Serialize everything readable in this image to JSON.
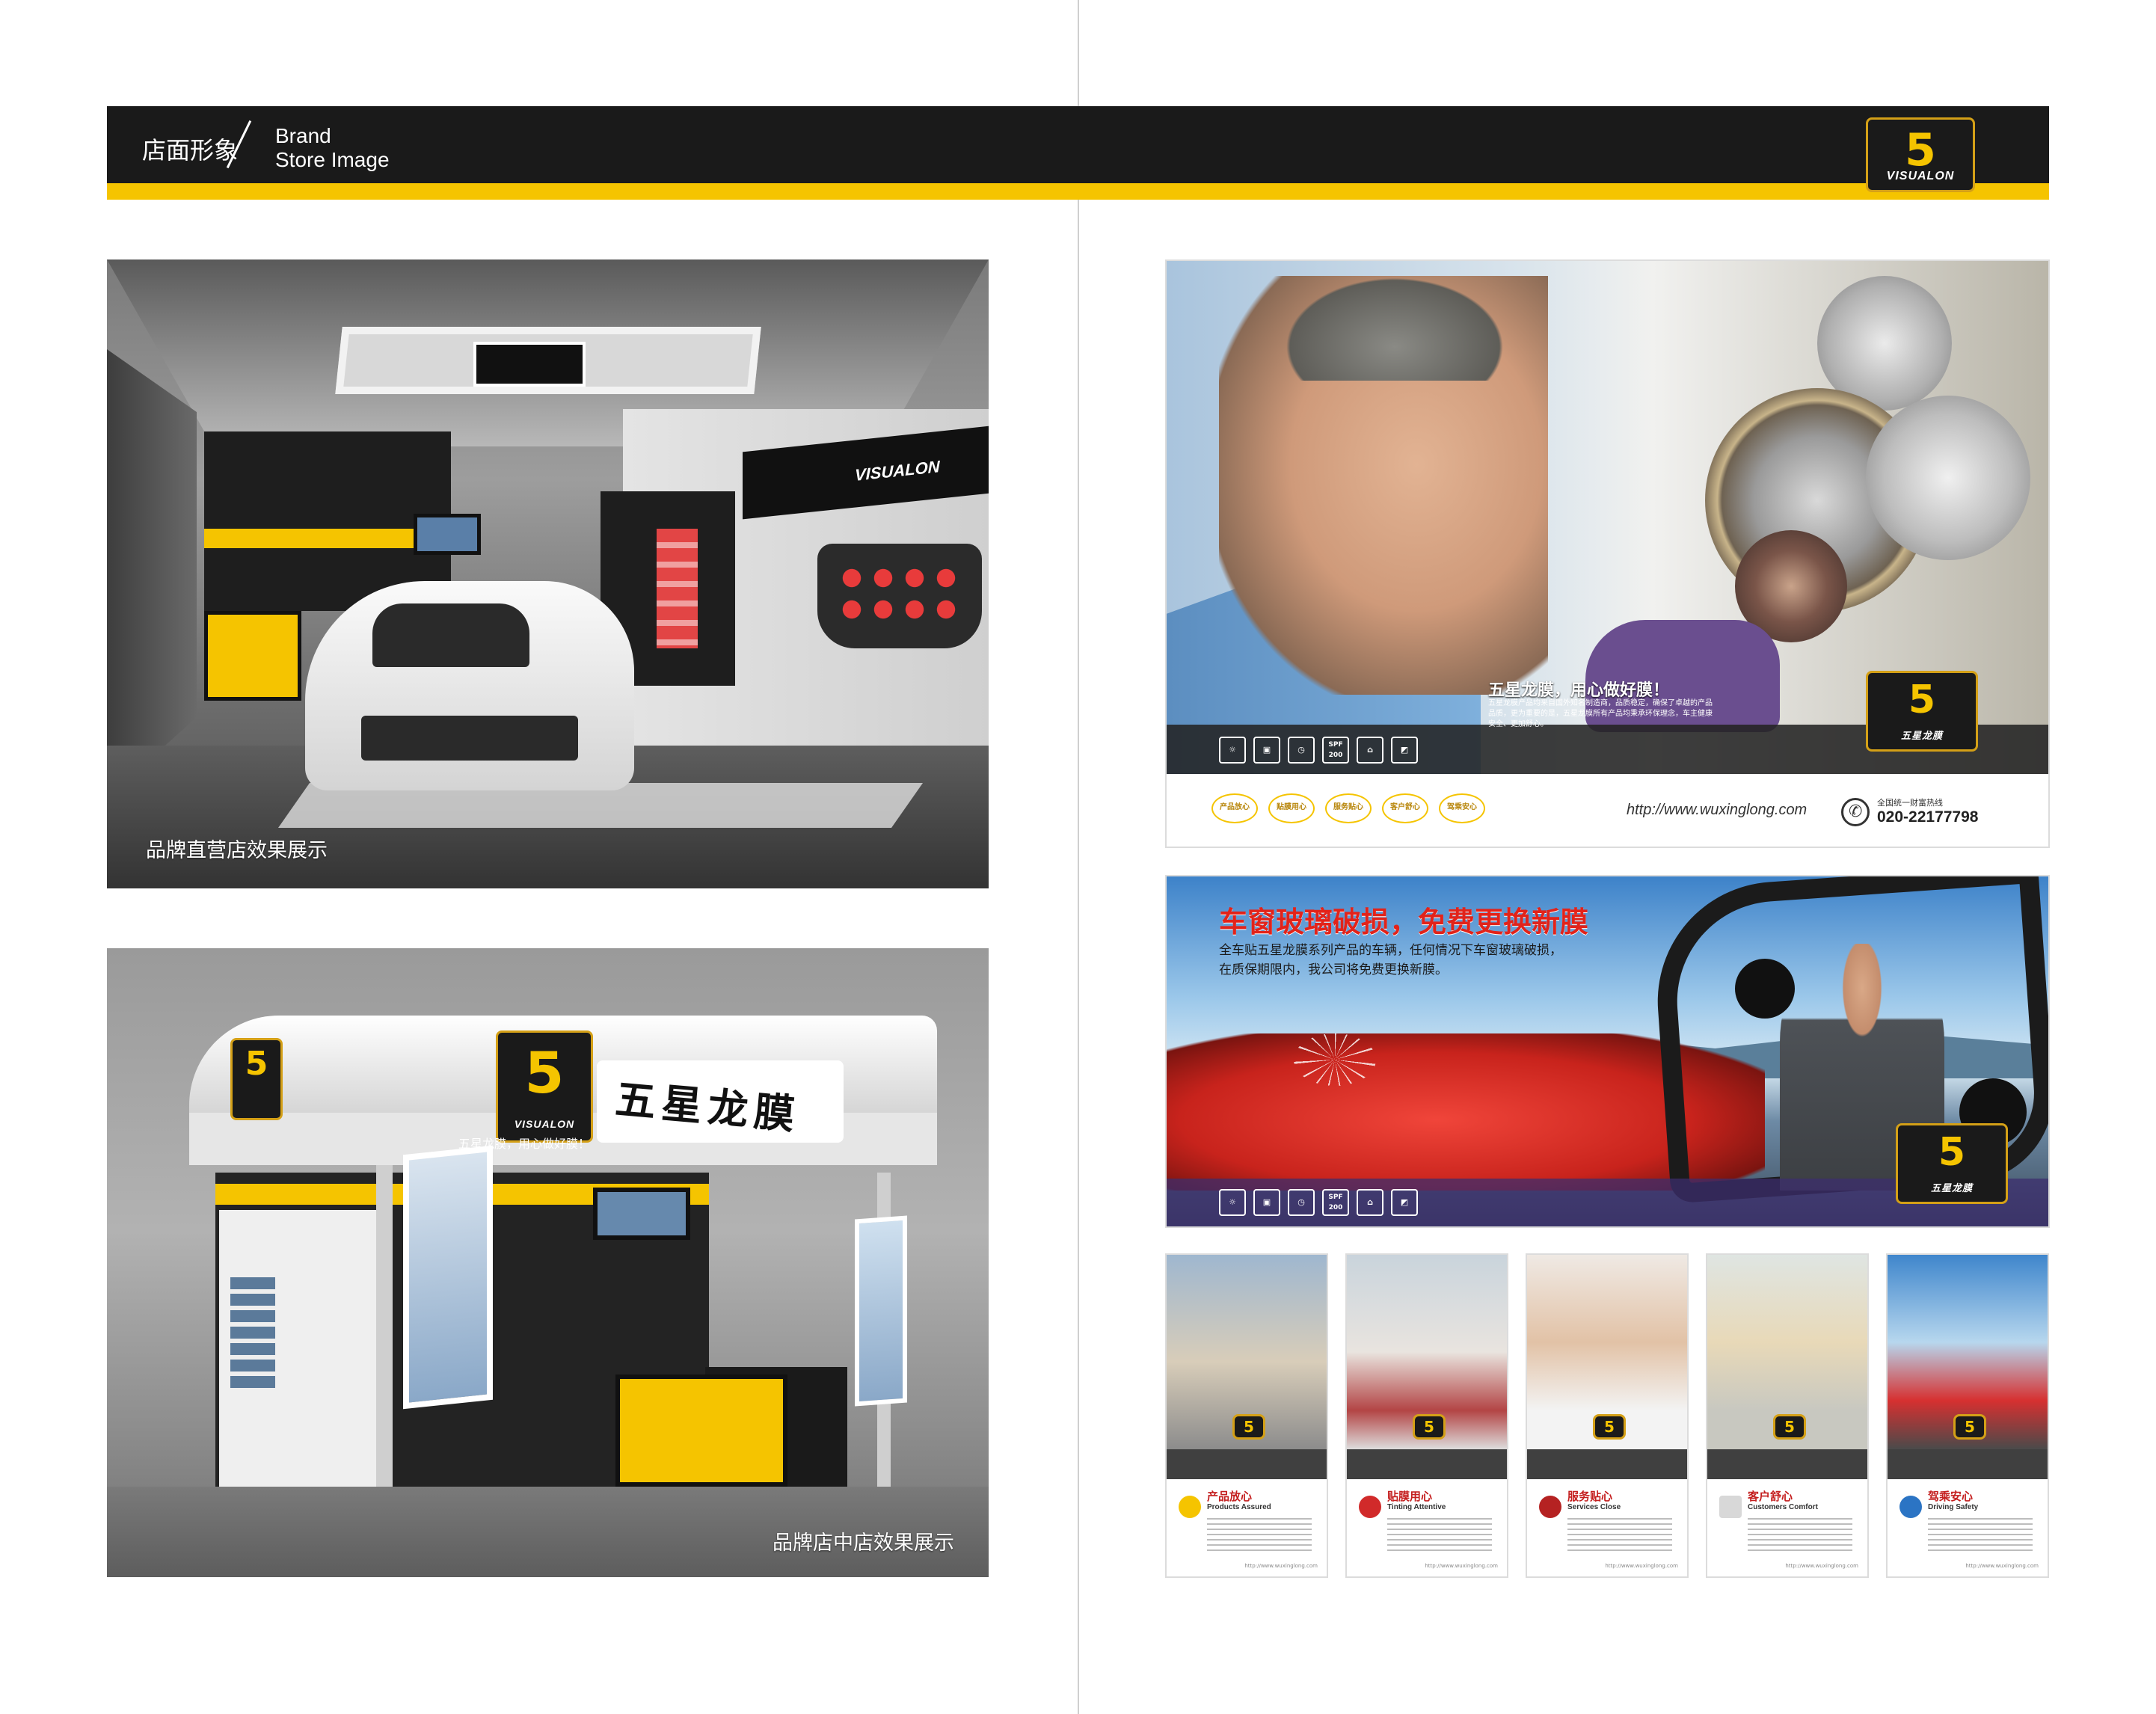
{
  "header": {
    "section_cn": "店面形象",
    "section_en_line1": "Brand",
    "section_en_line2": "Store Image",
    "logo_letter": "5",
    "logo_word": "VISUALON"
  },
  "colors": {
    "brand_yellow": "#f5c400",
    "header_black": "#1a1a1a",
    "accent_red": "#e2231a"
  },
  "left_page": {
    "store_direct": {
      "caption": "品牌直营店效果展示",
      "sign": "VISUALON"
    },
    "store_mall": {
      "caption": "品牌店中店效果展示",
      "sign_cn": "五星龙膜",
      "slogan": "五星龙膜，用心做好膜！"
    }
  },
  "right_page": {
    "ad_technician": {
      "title": "五星龙膜，用心做好膜！",
      "body": "五星龙膜产品均来自国外知名制造商，品质稳定，确保了卓越的产品品质，更为重要的是，五星龙膜所有产品均秉承环保理念，车主健康安全、更加舒心。",
      "feature_icons": [
        "☼",
        "▣",
        "◷",
        "SPF 200",
        "⌂",
        "◩"
      ],
      "pills": [
        "产品放心",
        "贴膜用心",
        "服务贴心",
        "客户舒心",
        "驾乘安心"
      ],
      "url": "http://www.wuxinglong.com",
      "hotline_label": "全国统一财富热线",
      "phone": "020-22177798",
      "logo_cn": "五星龙膜"
    },
    "ad_windshield": {
      "headline": "车窗玻璃破损，免费更换新膜",
      "body_line1": "全车贴五星龙膜系列产品的车辆，任何情况下车窗玻璃破损，",
      "body_line2": "在质保期限内，我公司将免费更换新膜。",
      "feature_icons": [
        "☼",
        "▣",
        "◷",
        "SPF 200",
        "⌂",
        "◩"
      ],
      "logo_cn": "五星龙膜"
    },
    "posters": [
      {
        "cn": "产品放心",
        "en": "Products Assured",
        "url": "http://www.wuxinglong.com"
      },
      {
        "cn": "贴膜用心",
        "en": "Tinting Attentive",
        "url": "http://www.wuxinglong.com"
      },
      {
        "cn": "服务贴心",
        "en": "Services Close",
        "url": "http://www.wuxinglong.com"
      },
      {
        "cn": "客户舒心",
        "en": "Customers Comfort",
        "url": "http://www.wuxinglong.com"
      },
      {
        "cn": "驾乘安心",
        "en": "Driving Safety",
        "url": "http://www.wuxinglong.com"
      }
    ]
  }
}
